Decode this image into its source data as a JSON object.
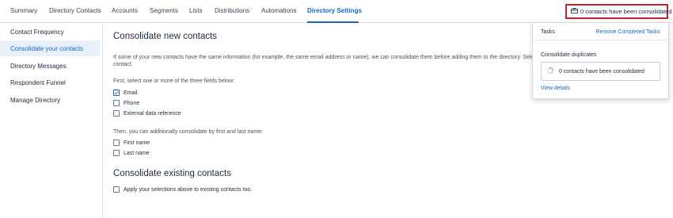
{
  "nav": {
    "tabs": [
      {
        "label": "Summary"
      },
      {
        "label": "Directory Contacts"
      },
      {
        "label": "Accounts"
      },
      {
        "label": "Segments"
      },
      {
        "label": "Lists"
      },
      {
        "label": "Distributions"
      },
      {
        "label": "Automations"
      },
      {
        "label": "Directory Settings",
        "active": true
      }
    ],
    "consolidated_button": "0 contacts have been consolidated"
  },
  "sidebar": {
    "items": [
      {
        "label": "Contact Frequency"
      },
      {
        "label": "Consolidate your contacts",
        "active": true
      },
      {
        "label": "Directory Messages"
      },
      {
        "label": "Respondent Funnel"
      },
      {
        "label": "Manage Directory"
      }
    ]
  },
  "main": {
    "title": "Consolidate new contacts",
    "intro_line1": "If some of your new contacts have the same information (for example, the same email address or name), we can consolidate them before adding them to the directory. Sele",
    "intro_line2": "contact.",
    "fields_prompt": "First, select one or more of the three fields below:",
    "fields": [
      {
        "label": "Email",
        "checked": true
      },
      {
        "label": "Phone",
        "checked": false
      },
      {
        "label": "External data reference",
        "checked": false
      }
    ],
    "name_prompt": "Then, you can additionally consolidate by first and last name:",
    "name_fields": [
      {
        "label": "First name",
        "checked": false
      },
      {
        "label": "Last name",
        "checked": false
      }
    ],
    "existing_title": "Consolidate existing contacts",
    "existing_option": {
      "label": "Apply your selections above to existing contacts too.",
      "checked": false
    }
  },
  "popover": {
    "title": "Tasks",
    "remove_link": "Remove Completed Tasks",
    "subtitle": "Consolidate duplicates",
    "status": "0 contacts have been consolidated",
    "details_link": "View details"
  },
  "colors": {
    "accent": "#1668c1",
    "highlight_border": "#c7202f",
    "active_bg": "#e8f1fb"
  }
}
